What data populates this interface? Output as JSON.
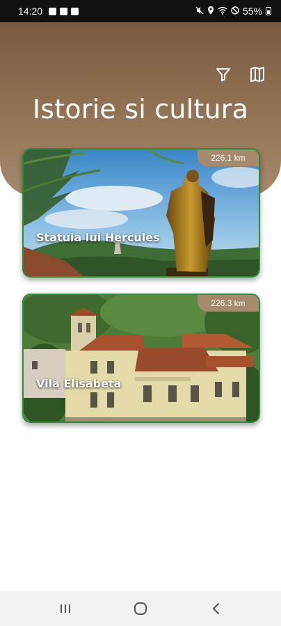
{
  "status_bar": {
    "time": "14:20",
    "battery": "55%",
    "left_icons": [
      "image-icon",
      "app-icon",
      "hand-icon"
    ],
    "right_icons": [
      "mute-icon",
      "location-icon",
      "wifi-icon",
      "do-not-disturb-icon",
      "battery-icon"
    ]
  },
  "header": {
    "title": "Istorie si cultura",
    "filter_icon": "filter-icon",
    "map_icon": "map-icon",
    "color": "#8c6c4f"
  },
  "cards": [
    {
      "title": "Statuia lui Hercules",
      "distance": "226.1 km"
    },
    {
      "title": "Vila Elisabeta",
      "distance": "226.3 km"
    }
  ],
  "colors": {
    "card_border": "#2e8b3a",
    "badge": "#a68a6d"
  },
  "nav_bar": {
    "icons": [
      "recent-apps-icon",
      "home-icon",
      "back-icon"
    ]
  }
}
